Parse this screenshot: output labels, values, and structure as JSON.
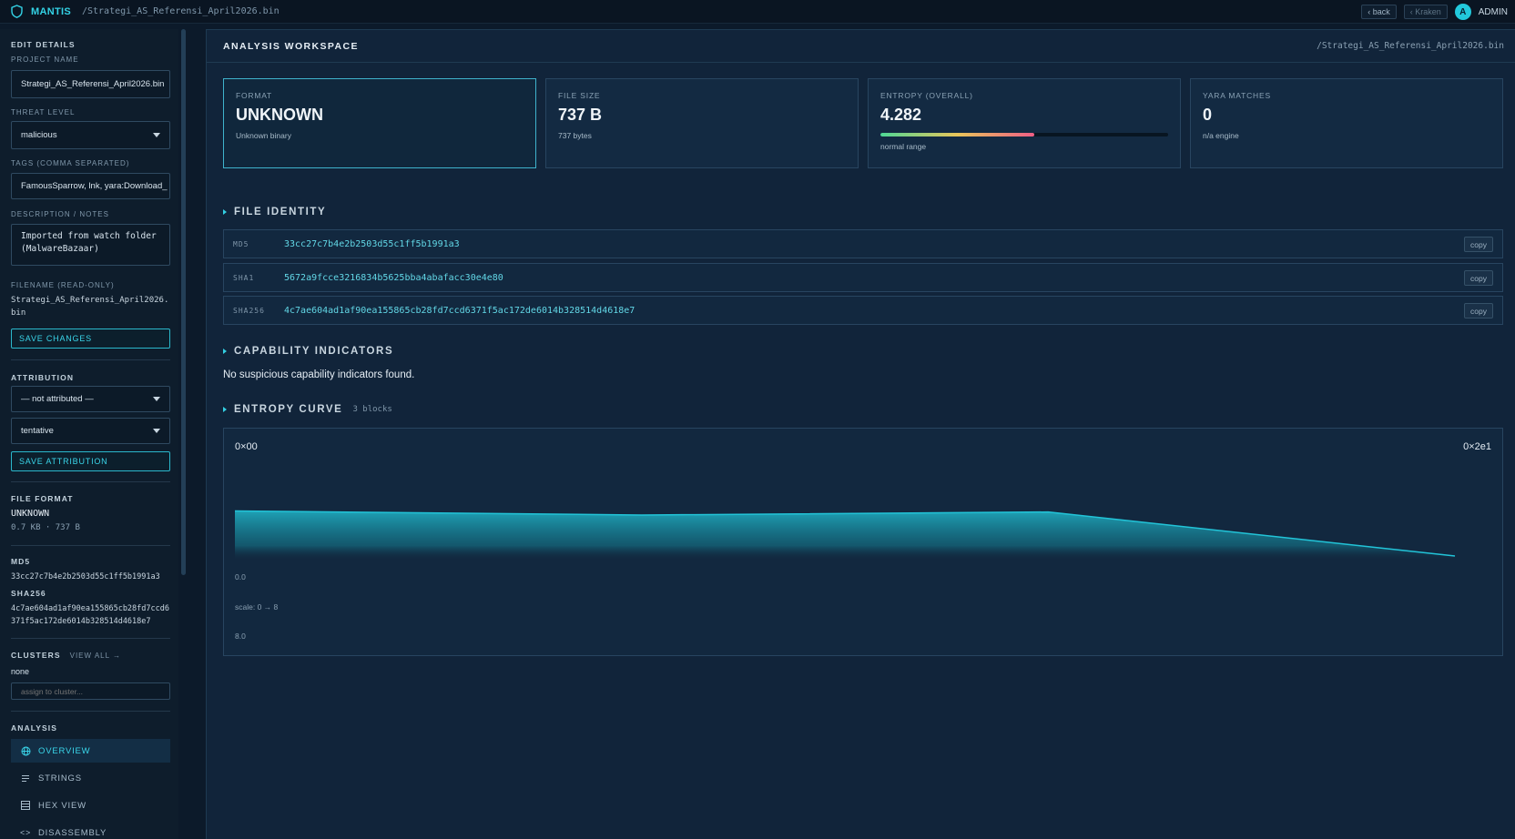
{
  "topbar": {
    "app_name": "MANTIS",
    "path": "/Strategi_AS_Referensi_April2026.bin",
    "back_label": "‹ back",
    "kraken_label": "‹ Kraken",
    "avatar_letter": "A",
    "user_label": "ADMIN"
  },
  "sidebar": {
    "edit_details_title": "EDIT DETAILS",
    "project_name_label": "PROJECT NAME",
    "project_name_value": "Strategi_AS_Referensi_April2026.bin",
    "threat_level_label": "THREAT LEVEL",
    "threat_level_value": "malicious",
    "tags_label": "TAGS (COMMA SEPARATED)",
    "tags_value": "FamousSparrow, lnk, yara:Download_",
    "description_label": "DESCRIPTION / NOTES",
    "description_value": "Imported from watch folder (MalwareBazaar)",
    "filename_label": "FILENAME (READ-ONLY)",
    "filename_value": "Strategi_AS_Referensi_April2026.bin",
    "save_changes_label": "SAVE CHANGES",
    "attribution_title": "ATTRIBUTION",
    "attribution_value": "— not attributed —",
    "confidence_value": "tentative",
    "save_attribution_label": "SAVE ATTRIBUTION",
    "file_format_title": "FILE FORMAT",
    "file_format_value": "UNKNOWN",
    "file_size_value": "0.7 KB · 737 B",
    "md5_label": "MD5",
    "md5_value": "33cc27c7b4e2b2503d55c1ff5b1991a3",
    "sha256_label": "SHA256",
    "sha256_value": "4c7ae604ad1af90ea155865cb28fd7ccd6371f5ac172de6014b328514d4618e7",
    "clusters_title": "CLUSTERS",
    "view_all_label": "VIEW ALL →",
    "clusters_value": "none",
    "assign_placeholder": "assign to cluster...",
    "analysis_title": "ANALYSIS",
    "nav": [
      {
        "label": "OVERVIEW",
        "icon": "globe-icon"
      },
      {
        "label": "STRINGS",
        "icon": "lines-icon"
      },
      {
        "label": "HEX VIEW",
        "icon": "grid-icon"
      },
      {
        "label": "DISASSEMBLY",
        "icon": "code-icon"
      }
    ]
  },
  "main": {
    "title": "ANALYSIS WORKSPACE",
    "path": "/Strategi_AS_Referensi_April2026.bin",
    "cards": [
      {
        "label": "FORMAT",
        "value": "UNKNOWN",
        "sub": "Unknown binary"
      },
      {
        "label": "FILE SIZE",
        "value": "737 B",
        "sub": "737 bytes"
      },
      {
        "label": "ENTROPY (OVERALL)",
        "value": "4.282",
        "sub": "normal range",
        "fill": 0.535
      },
      {
        "label": "YARA MATCHES",
        "value": "0",
        "sub": "n/a engine"
      }
    ],
    "file_identity_title": "FILE IDENTITY",
    "hashes": [
      {
        "key": "MD5",
        "value": "33cc27c7b4e2b2503d55c1ff5b1991a3",
        "copy": "copy"
      },
      {
        "key": "SHA1",
        "value": "5672a9fcce3216834b5625bba4abafacc30e4e80",
        "copy": "copy"
      },
      {
        "key": "SHA256",
        "value": "4c7ae604ad1af90ea155865cb28fd7ccd6371f5ac172de6014b328514d4618e7",
        "copy": "copy"
      }
    ],
    "capability_title": "CAPABILITY INDICATORS",
    "capability_empty": "No suspicious capability indicators found.",
    "entropy_curve_title": "ENTROPY CURVE",
    "entropy_curve_meta": "3 blocks",
    "curve_start_offset": "0×00",
    "curve_end_offset": "0×2e1",
    "curve_y0_label": "0.0",
    "curve_scale_label": "scale: 0 → 8",
    "curve_y8_label": "8.0"
  },
  "chart_data": {
    "type": "area",
    "x": [
      0,
      1,
      2,
      3
    ],
    "values": [
      4.4,
      4.0,
      4.3,
      0.0
    ],
    "ylim": [
      0,
      8
    ],
    "colors": {
      "line": "#22c4d8",
      "fill": "#1aa3b8"
    }
  }
}
